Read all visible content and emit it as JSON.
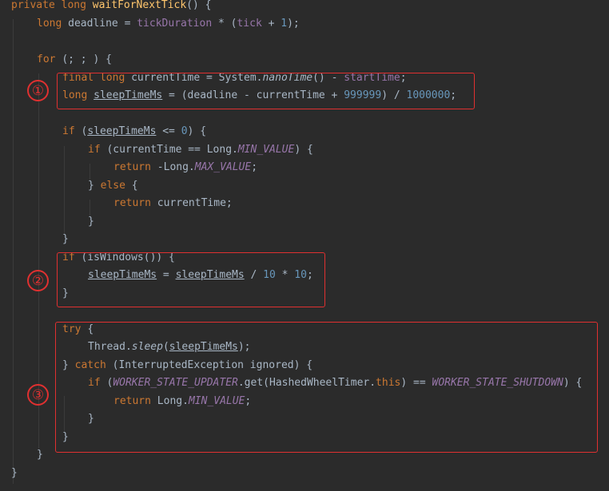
{
  "code": {
    "lines": [
      [
        [
          "kw",
          "private "
        ],
        [
          "kw",
          "long "
        ],
        [
          "fn",
          "waitForNextTick"
        ],
        [
          "plain",
          "() {"
        ]
      ],
      [
        [
          "kw",
          "long "
        ],
        [
          "plain",
          "deadline = "
        ],
        [
          "field",
          "tickDuration"
        ],
        [
          "plain",
          " * ("
        ],
        [
          "field",
          "tick"
        ],
        [
          "plain",
          " + "
        ],
        [
          "num",
          "1"
        ],
        [
          "plain",
          ");"
        ]
      ],
      [],
      [
        [
          "kw",
          "for "
        ],
        [
          "plain",
          "(; ; ) {"
        ]
      ],
      [
        [
          "kw",
          "final "
        ],
        [
          "kw",
          "long "
        ],
        [
          "plain",
          "currentTime = System."
        ],
        [
          "static",
          "nanoTime"
        ],
        [
          "plain",
          "() - "
        ],
        [
          "field",
          "startTime"
        ],
        [
          "plain",
          ";"
        ]
      ],
      [
        [
          "kw",
          "long "
        ],
        [
          "var",
          "sleepTimeMs"
        ],
        [
          "plain",
          " = (deadline - currentTime + "
        ],
        [
          "num",
          "999999"
        ],
        [
          "plain",
          ") / "
        ],
        [
          "num",
          "1000000"
        ],
        [
          "plain",
          ";"
        ]
      ],
      [],
      [
        [
          "kw",
          "if "
        ],
        [
          "plain",
          "("
        ],
        [
          "var",
          "sleepTimeMs"
        ],
        [
          "plain",
          " <= "
        ],
        [
          "num",
          "0"
        ],
        [
          "plain",
          ") {"
        ]
      ],
      [
        [
          "kw",
          "if "
        ],
        [
          "plain",
          "(currentTime == Long."
        ],
        [
          "const",
          "MIN_VALUE"
        ],
        [
          "plain",
          ") {"
        ]
      ],
      [
        [
          "kw",
          "return "
        ],
        [
          "plain",
          "-Long."
        ],
        [
          "const",
          "MAX_VALUE"
        ],
        [
          "plain",
          ";"
        ]
      ],
      [
        [
          "plain",
          "} "
        ],
        [
          "kw",
          "else "
        ],
        [
          "plain",
          "{"
        ]
      ],
      [
        [
          "kw",
          "return "
        ],
        [
          "plain",
          "currentTime;"
        ]
      ],
      [
        [
          "plain",
          "}"
        ]
      ],
      [
        [
          "plain",
          "}"
        ]
      ],
      [
        [
          "kw",
          "if "
        ],
        [
          "plain",
          "(isWindows()) {"
        ]
      ],
      [
        [
          "var",
          "sleepTimeMs"
        ],
        [
          "plain",
          " = "
        ],
        [
          "var",
          "sleepTimeMs"
        ],
        [
          "plain",
          " / "
        ],
        [
          "num",
          "10"
        ],
        [
          "plain",
          " * "
        ],
        [
          "num",
          "10"
        ],
        [
          "plain",
          ";"
        ]
      ],
      [
        [
          "plain",
          "}"
        ]
      ],
      [],
      [
        [
          "kw",
          "try "
        ],
        [
          "plain",
          "{"
        ]
      ],
      [
        [
          "plain",
          "Thread."
        ],
        [
          "static",
          "sleep"
        ],
        [
          "plain",
          "("
        ],
        [
          "var",
          "sleepTimeMs"
        ],
        [
          "plain",
          ");"
        ]
      ],
      [
        [
          "plain",
          "} "
        ],
        [
          "kw",
          "catch "
        ],
        [
          "plain",
          "(InterruptedException ignored) {"
        ]
      ],
      [
        [
          "kw",
          "if "
        ],
        [
          "plain",
          "("
        ],
        [
          "const",
          "WORKER_STATE_UPDATER"
        ],
        [
          "plain",
          ".get(HashedWheelTimer."
        ],
        [
          "kw",
          "this"
        ],
        [
          "plain",
          ") == "
        ],
        [
          "const",
          "WORKER_STATE_SHUTDOWN"
        ],
        [
          "plain",
          ") {"
        ]
      ],
      [
        [
          "kw",
          "return "
        ],
        [
          "plain",
          "Long."
        ],
        [
          "const",
          "MIN_VALUE"
        ],
        [
          "plain",
          ";"
        ]
      ],
      [
        [
          "plain",
          "}"
        ]
      ],
      [
        [
          "plain",
          "}"
        ]
      ],
      [
        [
          "plain",
          "}"
        ]
      ],
      [
        [
          "plain",
          "}"
        ]
      ]
    ]
  },
  "annotations": [
    {
      "label": "①"
    },
    {
      "label": "②"
    },
    {
      "label": "③"
    }
  ],
  "colors": {
    "background": "#2b2b2b",
    "text": "#a9b7c6",
    "keyword": "#cc7832",
    "method": "#ffc66d",
    "number": "#6897bb",
    "field": "#9876aa",
    "annotation": "#e03030"
  }
}
